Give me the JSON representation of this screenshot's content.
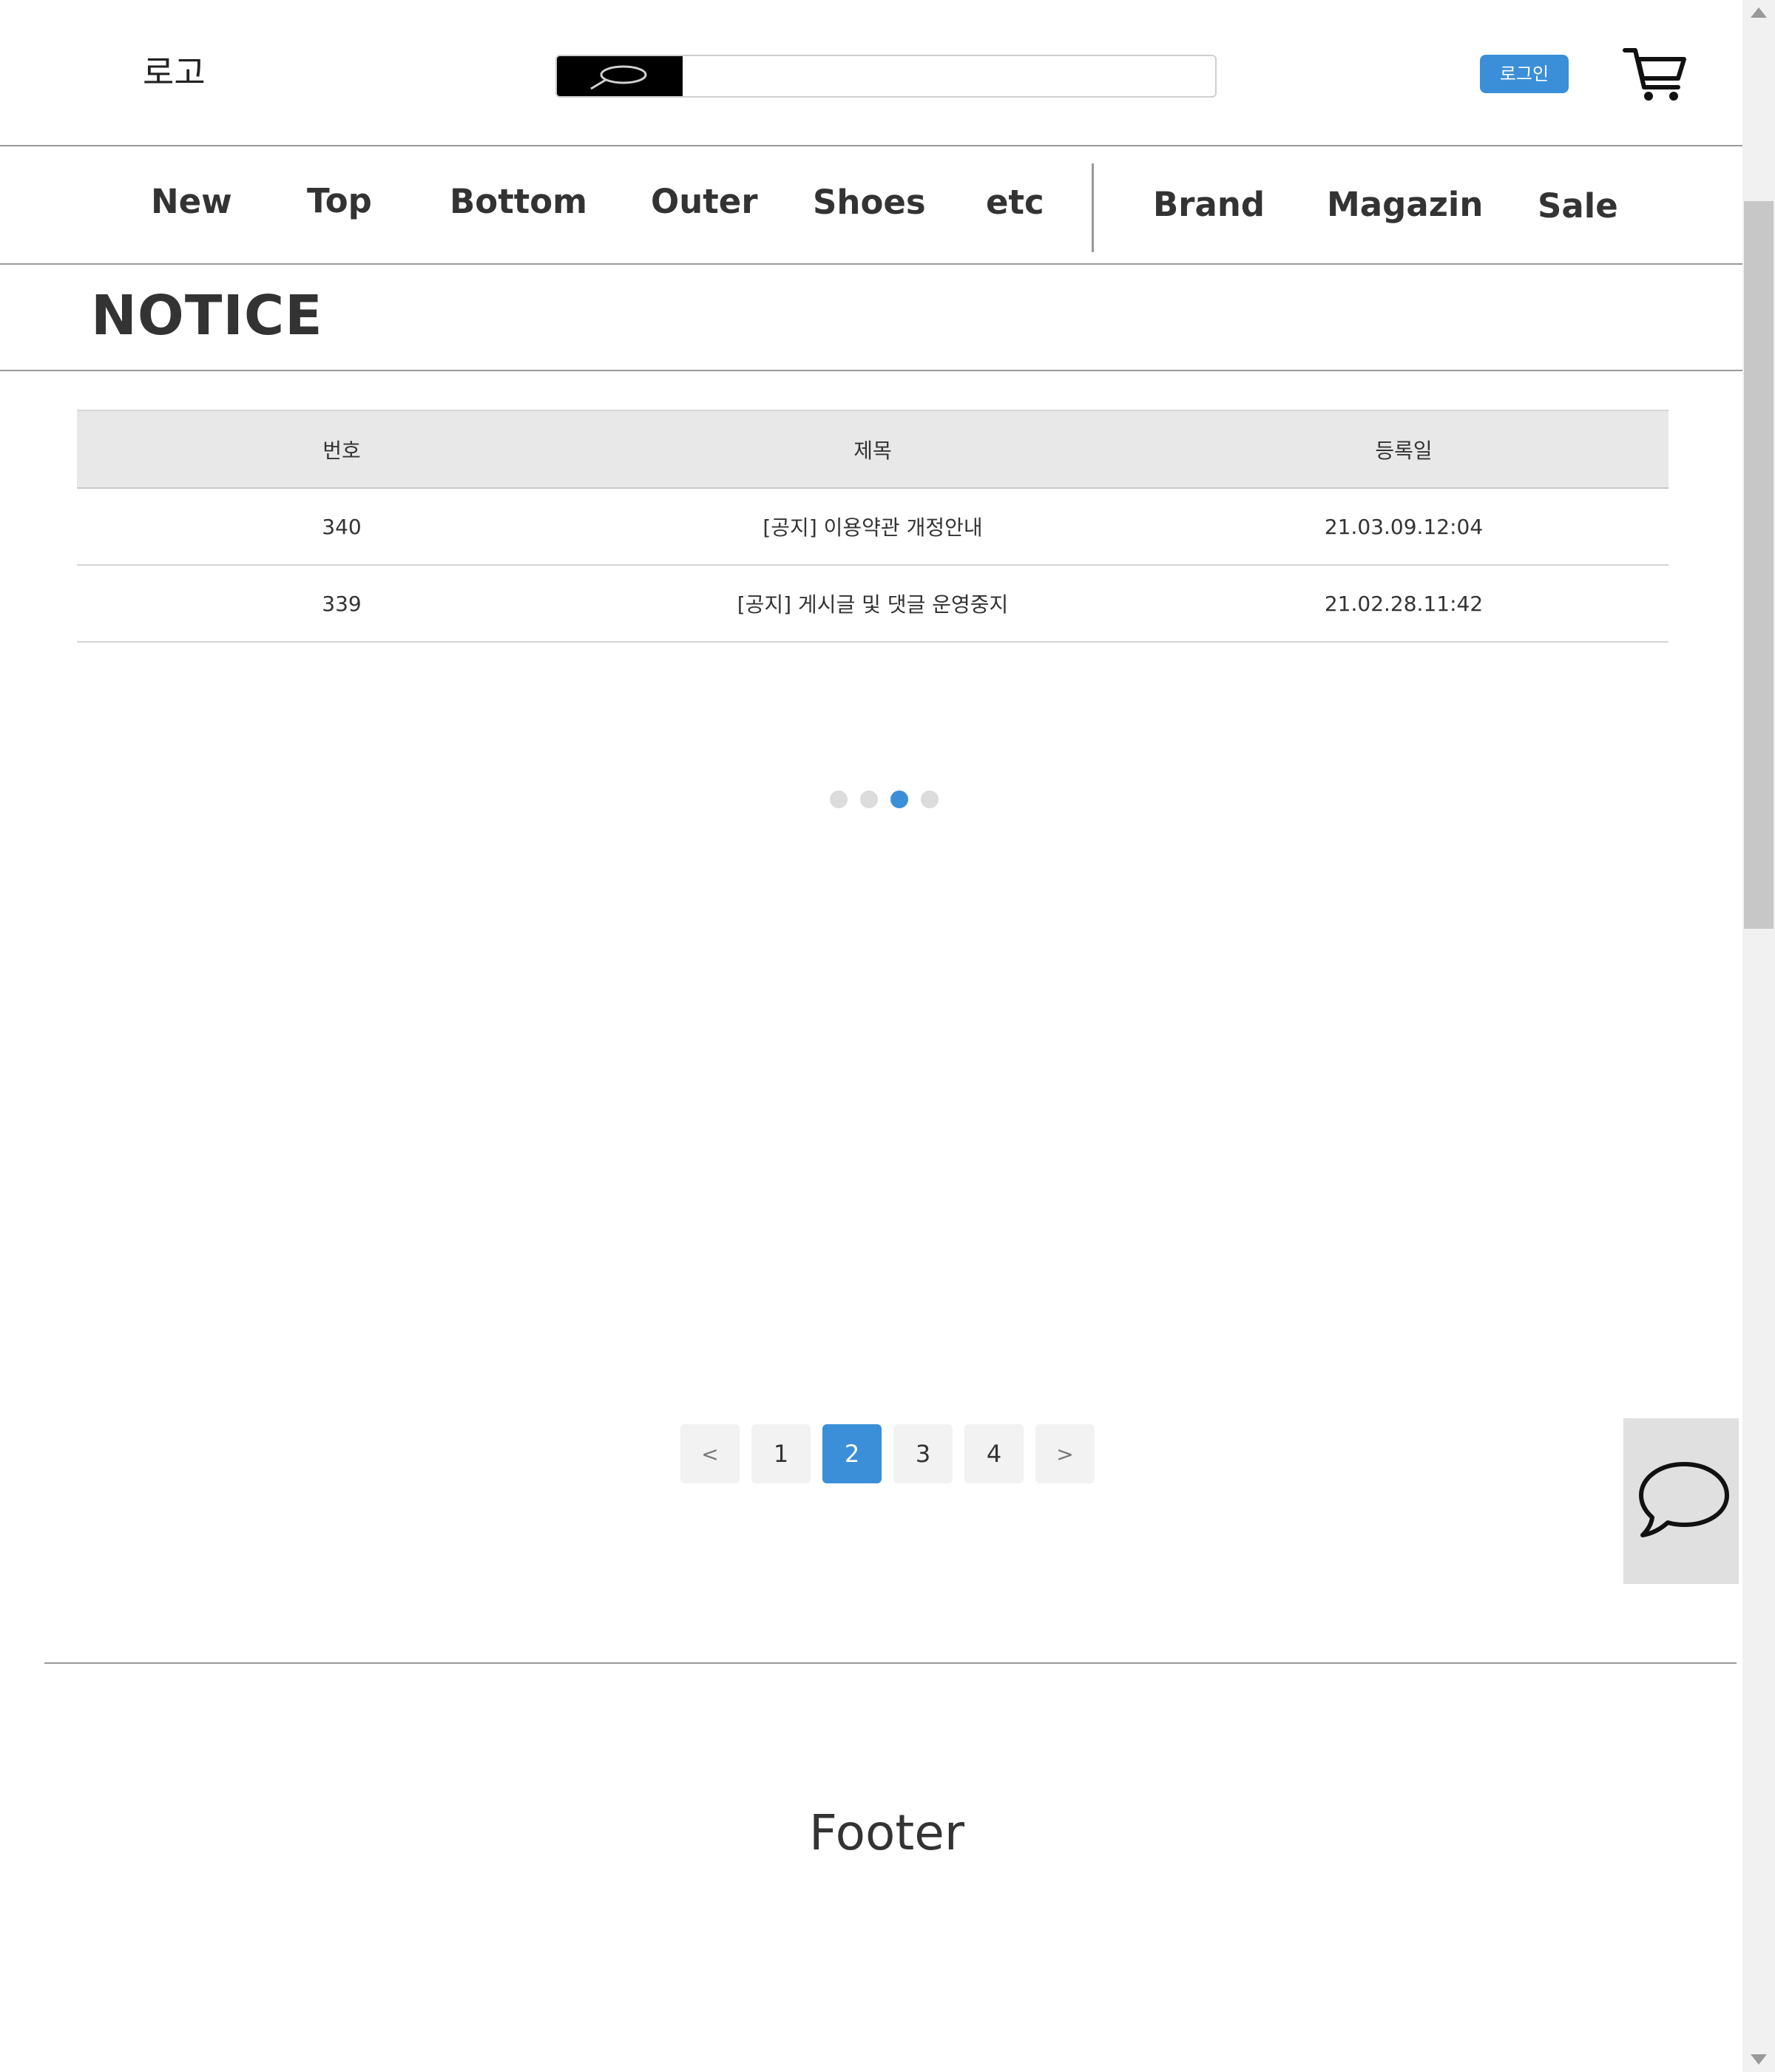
{
  "header": {
    "logo": "로고",
    "search_placeholder": "",
    "login_label": "로그인"
  },
  "nav": {
    "items": [
      "New",
      "Top",
      "Bottom",
      "Outer",
      "Shoes",
      "etc",
      "Brand",
      "Magazin",
      "Sale"
    ]
  },
  "notice": {
    "title": "NOTICE",
    "columns": [
      "번호",
      "제목",
      "등록일"
    ],
    "rows": [
      {
        "no": "340",
        "subject": "[공지] 이용약관 개정안내",
        "date": "21.03.09.12:04"
      },
      {
        "no": "339",
        "subject": "[공지] 게시글 및 댓글 운영중지",
        "date": "21.02.28.11:42"
      }
    ]
  },
  "carousel": {
    "dot_count": 4,
    "active_index": 2
  },
  "pagination": {
    "prev": "<",
    "pages": [
      "1",
      "2",
      "3",
      "4"
    ],
    "current": "2",
    "next": ">"
  },
  "footer": {
    "text": "Footer"
  },
  "colors": {
    "accent": "#3b8fd8",
    "header_bg": "#e8e8e8"
  },
  "icons": [
    "search-icon",
    "cart-icon",
    "chat-icon"
  ]
}
